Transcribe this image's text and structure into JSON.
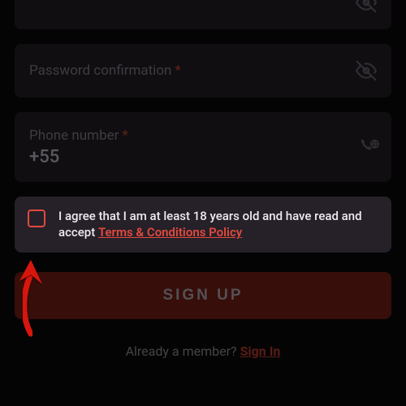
{
  "fields": {
    "password_confirm": {
      "label": "Password confirmation"
    },
    "phone": {
      "label": "Phone number",
      "value": "+55"
    }
  },
  "terms": {
    "prefix": "I agree that I am at least 18 years old and have read and accept ",
    "link": "Terms & Conditions Policy"
  },
  "signup_button": "SIGN UP",
  "already_member": {
    "prefix": "Already a member? ",
    "link": "Sign In"
  },
  "required_marker": "*"
}
